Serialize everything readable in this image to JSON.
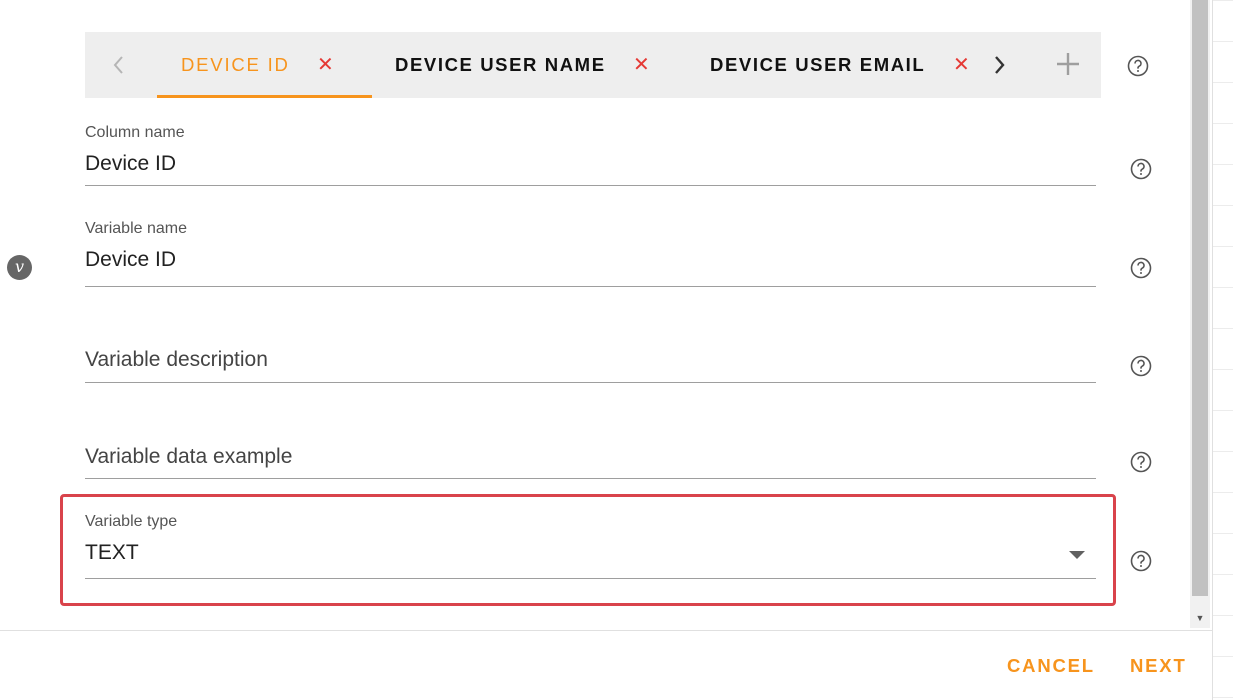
{
  "tabs": {
    "items": [
      {
        "label": "DEVICE ID",
        "active": true
      },
      {
        "label": "DEVICE USER NAME",
        "active": false
      },
      {
        "label": "DEVICE USER EMAIL",
        "active": false
      }
    ],
    "close_glyph": "✕",
    "left_icon": "chevron-left-icon",
    "right_icon": "chevron-right-icon",
    "add_icon": "plus-icon"
  },
  "fields": {
    "column_name": {
      "label": "Column name",
      "value": "Device ID"
    },
    "variable_name": {
      "label": "Variable name",
      "value": "Device ID"
    },
    "variable_description": {
      "placeholder": "Variable description"
    },
    "variable_data_example": {
      "placeholder": "Variable data example"
    },
    "variable_type": {
      "label": "Variable type",
      "value": "TEXT"
    }
  },
  "variable_badge": "v",
  "footer": {
    "cancel": "CANCEL",
    "next": "NEXT"
  },
  "colors": {
    "accent": "#f7941d",
    "close": "#e53935",
    "highlight": "#d9434b"
  }
}
